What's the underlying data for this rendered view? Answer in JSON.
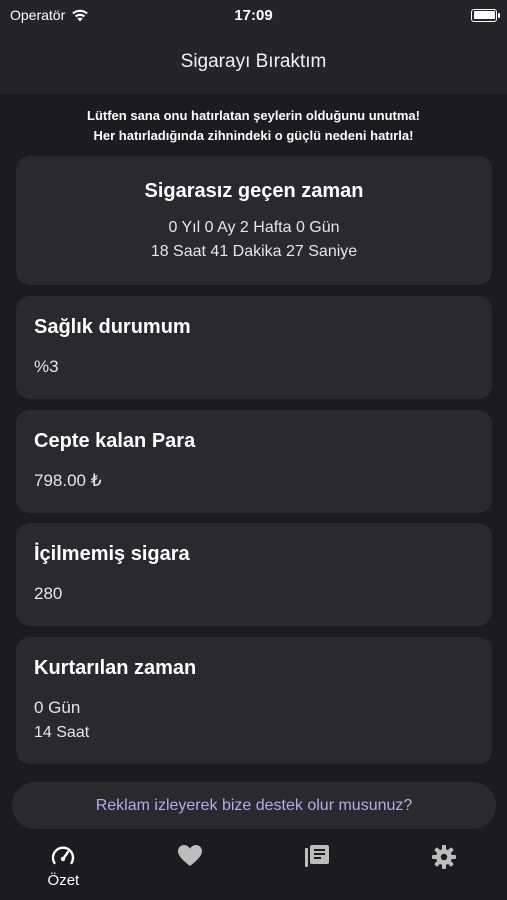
{
  "status_bar": {
    "carrier": "Operatör",
    "time": "17:09"
  },
  "nav": {
    "title": "Sigarayı Bıraktım"
  },
  "reminder": {
    "line1": "Lütfen sana onu hatırlatan şeylerin olduğunu unutma!",
    "line2": "Her hatırladığında zihnindeki o güçlü nedeni hatırla!"
  },
  "cards": {
    "time_without": {
      "title": "Sigarasız geçen zaman",
      "line1": "0 Yıl 0 Ay 2 Hafta 0 Gün",
      "line2": "18 Saat 41 Dakika 27 Saniye"
    },
    "health": {
      "title": "Sağlık durumum",
      "value": "%3"
    },
    "money": {
      "title": "Cepte kalan Para",
      "value": "798.00 ₺"
    },
    "cigarettes": {
      "title": "İçilmemiş sigara",
      "value": "280"
    },
    "saved_time": {
      "title": "Kurtarılan zaman",
      "days": "0 Gün",
      "hours": "14 Saat"
    }
  },
  "ad_banner": {
    "text": "Reklam izleyerek bize destek olur musunuz?"
  },
  "tabs": [
    {
      "label": "Özet",
      "icon": "speedometer-icon"
    },
    {
      "label": "",
      "icon": "heart-icon"
    },
    {
      "label": "",
      "icon": "library-icon"
    },
    {
      "label": "",
      "icon": "gear-icon"
    }
  ],
  "colors": {
    "background": "#1c1b1f",
    "card": "#2a292d",
    "accent_text": "#b8a9f0"
  }
}
